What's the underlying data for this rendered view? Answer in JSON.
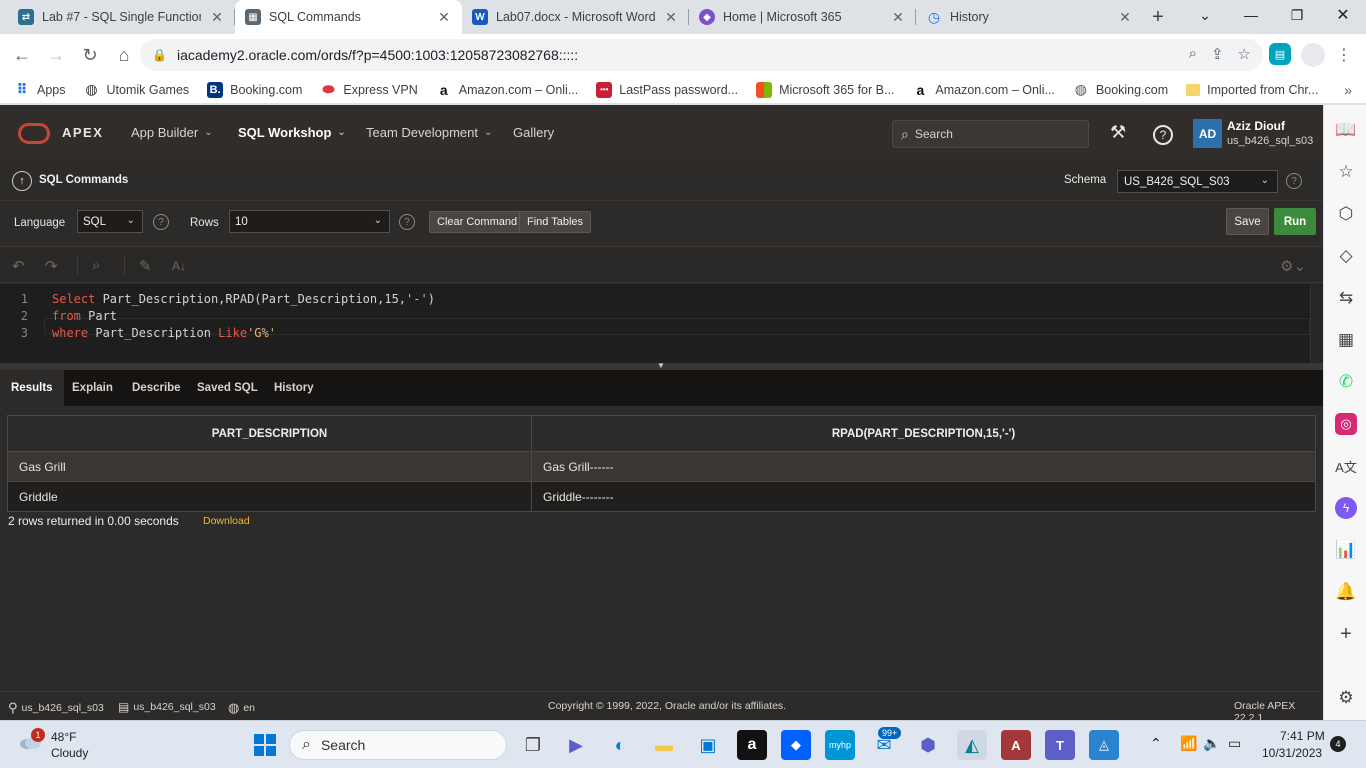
{
  "browser": {
    "tabs": [
      {
        "title": "Lab #7 - SQL Single Function",
        "icon": "sql-fiddle-icon",
        "active": false
      },
      {
        "title": "SQL Commands",
        "icon": "sql-icon",
        "active": true
      },
      {
        "title": "Lab07.docx - Microsoft Word",
        "icon": "word-icon",
        "active": false
      },
      {
        "title": "Home | Microsoft 365",
        "icon": "m365-icon",
        "active": false
      },
      {
        "title": "History",
        "icon": "history-icon",
        "active": false
      }
    ],
    "url": "iacademy2.oracle.com/ords/f?p=4500:1003:12058723082768:::::",
    "bookmarks": [
      {
        "label": "Apps",
        "icon": "apps-grid-icon"
      },
      {
        "label": "Utomik Games",
        "icon": "utomik-icon"
      },
      {
        "label": "Booking.com",
        "icon": "booking-icon"
      },
      {
        "label": "Express VPN",
        "icon": "expressvpn-icon"
      },
      {
        "label": "Amazon.com – Onli...",
        "icon": "amazon-icon"
      },
      {
        "label": "LastPass password...",
        "icon": "lastpass-icon"
      },
      {
        "label": "Microsoft 365 for B...",
        "icon": "microsoft-icon"
      },
      {
        "label": "Amazon.com – Onli...",
        "icon": "amazon-icon"
      },
      {
        "label": "Booking.com",
        "icon": "globe-icon"
      },
      {
        "label": "Imported from Chr...",
        "icon": "folder-icon"
      }
    ]
  },
  "apex": {
    "brand": "APEX",
    "nav": [
      {
        "label": "App Builder",
        "active": false,
        "dropdown": true
      },
      {
        "label": "SQL Workshop",
        "active": true,
        "dropdown": true
      },
      {
        "label": "Team Development",
        "active": false,
        "dropdown": true
      },
      {
        "label": "Gallery",
        "active": false,
        "dropdown": false
      }
    ],
    "search_placeholder": "Search",
    "user": {
      "initials": "AD",
      "name": "Aziz Diouf",
      "schema": "us_b426_sql_s03"
    },
    "page_title": "SQL Commands",
    "schema_label": "Schema",
    "schema_value": "US_B426_SQL_S03",
    "language_label": "Language",
    "language_value": "SQL",
    "rows_label": "Rows",
    "rows_value": "10",
    "clear_command_label": "Clear Command",
    "find_tables_label": "Find Tables",
    "save_label": "Save",
    "run_label": "Run",
    "editor": {
      "line_numbers": [
        "1",
        "2",
        "3"
      ],
      "line1": {
        "kw1": "Select",
        "t1": " Part_Description,RPAD(Part_Description,15,",
        "s1": "'-'",
        "t2": ")"
      },
      "line2": {
        "kw1": "from",
        "t1": " Part"
      },
      "line3": {
        "kw1": "where",
        "t1": " Part_Description ",
        "kw2": "Like",
        "s1": "'G%'"
      }
    },
    "result_tabs": [
      "Results",
      "Explain",
      "Describe",
      "Saved SQL",
      "History"
    ],
    "results": {
      "columns": [
        "PART_DESCRIPTION",
        "RPAD(PART_DESCRIPTION,15,'-')"
      ],
      "rows": [
        [
          "Gas Grill",
          "Gas Grill------"
        ],
        [
          "Griddle",
          "Griddle--------"
        ]
      ],
      "rows_info": "2 rows returned in 0.00 seconds",
      "download_label": "Download"
    },
    "footer": {
      "user": "us_b426_sql_s03",
      "schema": "us_b426_sql_s03",
      "language": "en",
      "copyright": "Copyright © 1999, 2022, Oracle and/or its affiliates.",
      "version": "Oracle APEX 22.2.1"
    },
    "colors": {
      "run": "#3c8b3c",
      "oracle_red": "#c74634",
      "download_link": "#f0b832"
    }
  },
  "taskbar": {
    "weather_temp": "48°F",
    "weather_cond": "Cloudy",
    "weather_badge": "1",
    "search_placeholder": "Search",
    "mail_badge": "99+",
    "time": "7:41 PM",
    "date": "10/31/2023",
    "notification_count": "4"
  }
}
